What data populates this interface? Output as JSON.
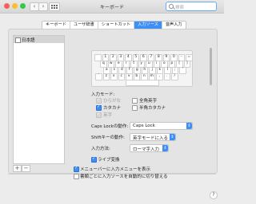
{
  "window": {
    "title": "キーボード"
  },
  "search": {
    "placeholder": "検索"
  },
  "tabs": [
    {
      "label": "キーボード",
      "active": false
    },
    {
      "label": "ユーザ辞書",
      "active": false
    },
    {
      "label": "ショートカット",
      "active": false
    },
    {
      "label": "入力ソース",
      "active": true
    },
    {
      "label": "音声入力",
      "active": false
    }
  ],
  "sources": {
    "items": [
      {
        "label": "日本語",
        "selected": true
      }
    ]
  },
  "source_buttons": {
    "add": "+",
    "remove": "−"
  },
  "keyboard": {
    "row1": [
      "",
      "1",
      "2",
      "3",
      "4",
      "5",
      "6",
      "7",
      "8",
      "9",
      "0",
      "-",
      "="
    ],
    "row2": [
      "q",
      "w",
      "e",
      "r",
      "t",
      "y",
      "u",
      "i",
      "o",
      "p",
      "[",
      "]"
    ],
    "row3": [
      "a",
      "s",
      "d",
      "f",
      "g",
      "h",
      "j",
      "k",
      "l",
      ";",
      "'"
    ],
    "row4": [
      "`",
      "z",
      "x",
      "c",
      "v",
      "b",
      "n",
      "m",
      ",",
      ".",
      "/"
    ]
  },
  "input_modes": {
    "heading": "入力モード:",
    "hiragana": "ひらがな",
    "katakana": "カタカナ",
    "eisu": "英字",
    "zenkaku": "全角英字",
    "hankaku": "半角カタカナ"
  },
  "caps_lock": {
    "label": "Caps Lockの動作:",
    "value": "Caps Lock"
  },
  "shift": {
    "label": "Shiftキーの動作:",
    "value": "英字モードに入る"
  },
  "input_method": {
    "label": "入力方法:",
    "value": "ローマ字入力"
  },
  "live_conversion": {
    "label": "ライブ変換"
  },
  "menu_bar": {
    "label": "メニューバーに入力メニューを表示"
  },
  "auto_switch": {
    "label": "書類ごとに入力ソースを自動的に切り替える"
  },
  "help": {
    "label": "?"
  }
}
